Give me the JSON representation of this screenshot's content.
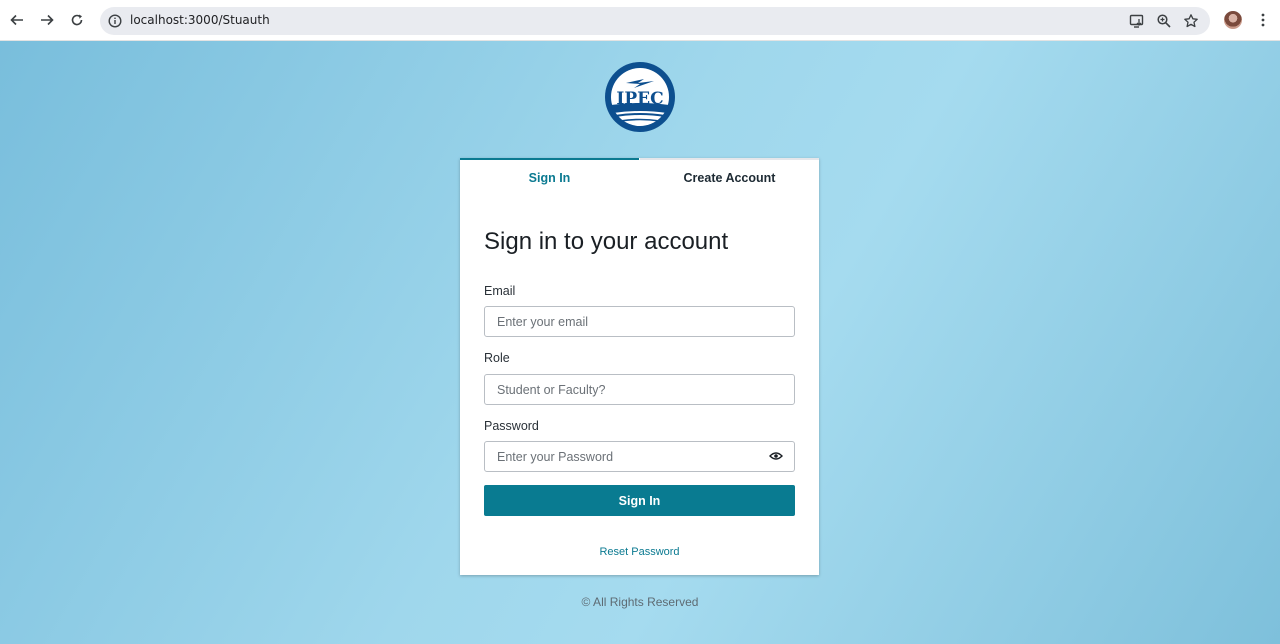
{
  "browser": {
    "url": "localhost:3000/Stuauth"
  },
  "logo": {
    "text": "IPEC"
  },
  "tabs": {
    "sign_in": "Sign In",
    "create_account": "Create Account"
  },
  "form": {
    "heading": "Sign in to your account",
    "email_label": "Email",
    "email_placeholder": "Enter your email",
    "role_label": "Role",
    "role_placeholder": "Student or Faculty?",
    "password_label": "Password",
    "password_placeholder": "Enter your Password",
    "submit_label": "Sign In",
    "reset_label": "Reset Password"
  },
  "footer": {
    "text": "© All Rights Reserved"
  },
  "colors": {
    "accent": "#097b91",
    "logo_blue": "#0d4f8f"
  }
}
